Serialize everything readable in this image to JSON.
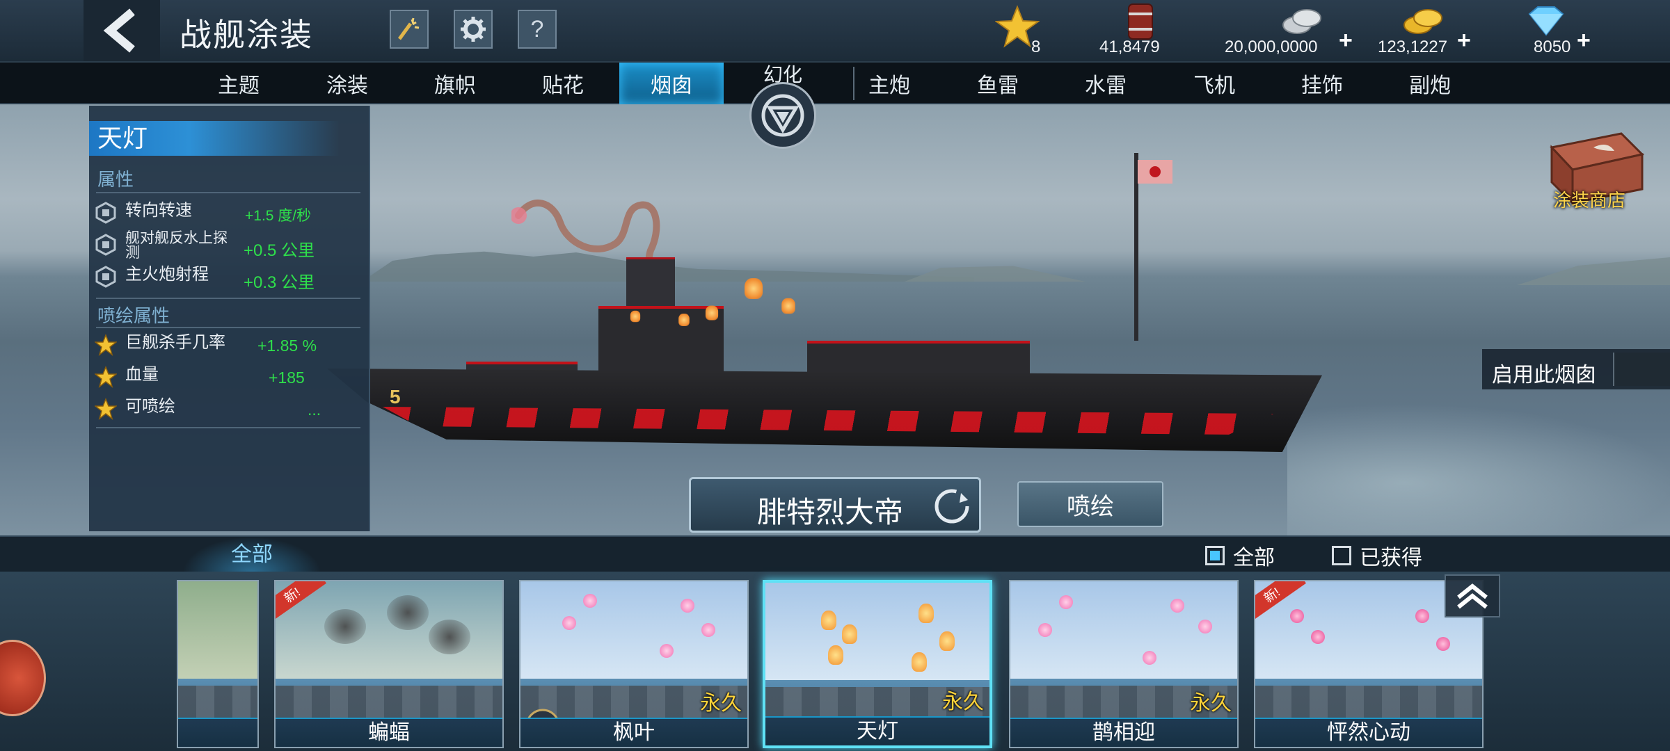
{
  "header": {
    "title": "战舰涂装",
    "resources": [
      {
        "name": "star-level",
        "value": "8"
      },
      {
        "name": "oil",
        "value": "41,8479"
      },
      {
        "name": "silver",
        "value": "20,000,0000"
      },
      {
        "name": "gold",
        "value": "123,1227"
      },
      {
        "name": "diamond",
        "value": "8050"
      }
    ],
    "plus": "+",
    "help": "?"
  },
  "tabs": [
    {
      "label": "主题"
    },
    {
      "label": "涂装"
    },
    {
      "label": "旗帜"
    },
    {
      "label": "贴花"
    },
    {
      "label": "烟囱",
      "active": true
    },
    {
      "label": "主炮"
    },
    {
      "label": "鱼雷"
    },
    {
      "label": "水雷"
    },
    {
      "label": "飞机"
    },
    {
      "label": "挂饰"
    },
    {
      "label": "副炮"
    }
  ],
  "huanhua": {
    "label": "幻化"
  },
  "panel": {
    "title": "天灯",
    "attr_header": "属性",
    "attrs": [
      {
        "name": "转向转速",
        "value": "+1.5 度/秒"
      },
      {
        "name": "舰对舰反水上探测",
        "value": "+0.5 公里"
      },
      {
        "name": "主火炮射程",
        "value": "+0.3 公里"
      }
    ],
    "paint_header": "喷绘属性",
    "paint_attrs": [
      {
        "name": "巨舰杀手几率",
        "value": "+1.85 %"
      },
      {
        "name": "血量",
        "value": "+185"
      },
      {
        "name": "可喷绘",
        "value": "..."
      }
    ]
  },
  "shop": {
    "label": "涂装商店"
  },
  "enable": {
    "label": "启用此烟囱"
  },
  "actions": {
    "ship_name": "腓特烈大帝",
    "paint": "喷绘"
  },
  "filter": {
    "tab": "全部",
    "all": "全部",
    "obtained": "已获得",
    "all_checked": true,
    "obtained_checked": false
  },
  "cards": [
    {
      "caption": "",
      "permanent": "",
      "new": ""
    },
    {
      "caption": "蝙蝠",
      "permanent": "",
      "new": "新!"
    },
    {
      "caption": "枫叶",
      "permanent": "永久",
      "new": ""
    },
    {
      "caption": "天灯",
      "permanent": "永久",
      "new": "",
      "selected": true
    },
    {
      "caption": "鹊相迎",
      "permanent": "永久",
      "new": ""
    },
    {
      "caption": "怦然心动",
      "permanent": "",
      "new": "新!"
    }
  ],
  "colors": {
    "accent": "#1b8ec8",
    "green_value": "#2ee04b",
    "gold": "#ffd33a"
  }
}
